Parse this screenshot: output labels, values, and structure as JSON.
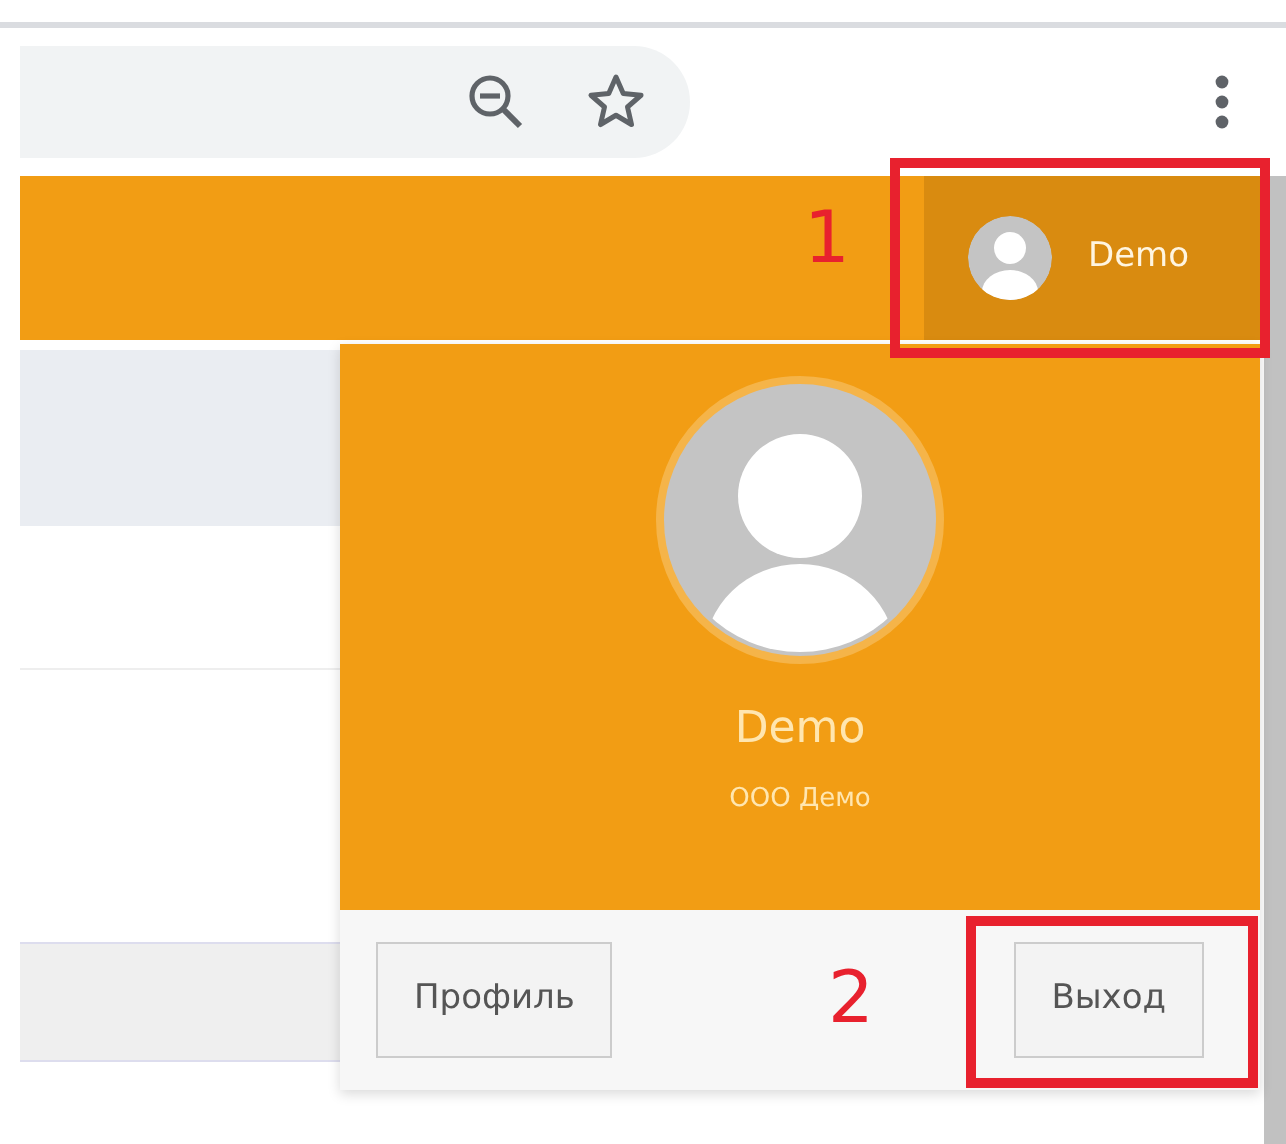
{
  "navbar": {
    "user_name": "Demo",
    "menu_open": true
  },
  "user_menu": {
    "name": "Demo",
    "company": "ООО Демо",
    "buttons": [
      "Профиль",
      "Выход"
    ]
  },
  "annotations": [
    {
      "label": "1"
    },
    {
      "label": "2"
    }
  ]
}
